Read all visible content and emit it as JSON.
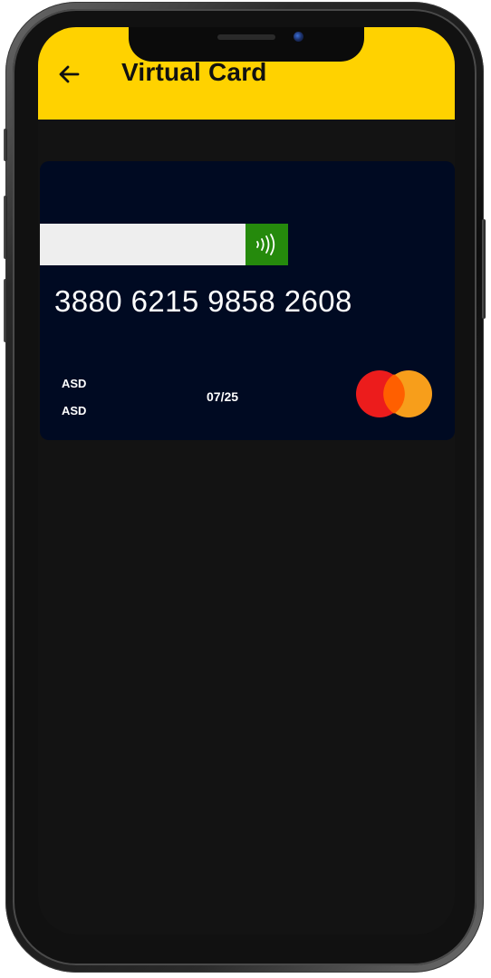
{
  "app_bar": {
    "title": "Virtual Card",
    "back_icon": "arrow-left-icon",
    "background_color": "#ffd200"
  },
  "card": {
    "number": "3880 6215 9858 2608",
    "holder_line_1": "ASD",
    "holder_line_2": "ASD",
    "expiry": "07/25",
    "brand_icon": "mastercard-logo",
    "contactless_icon": "contactless-icon",
    "background_color": "#000a22",
    "contactless_color": "#258a0c"
  },
  "colors": {
    "screen_background": "#131313",
    "mastercard_red": "#ec1c1c",
    "mastercard_orange": "#f79e1b"
  }
}
